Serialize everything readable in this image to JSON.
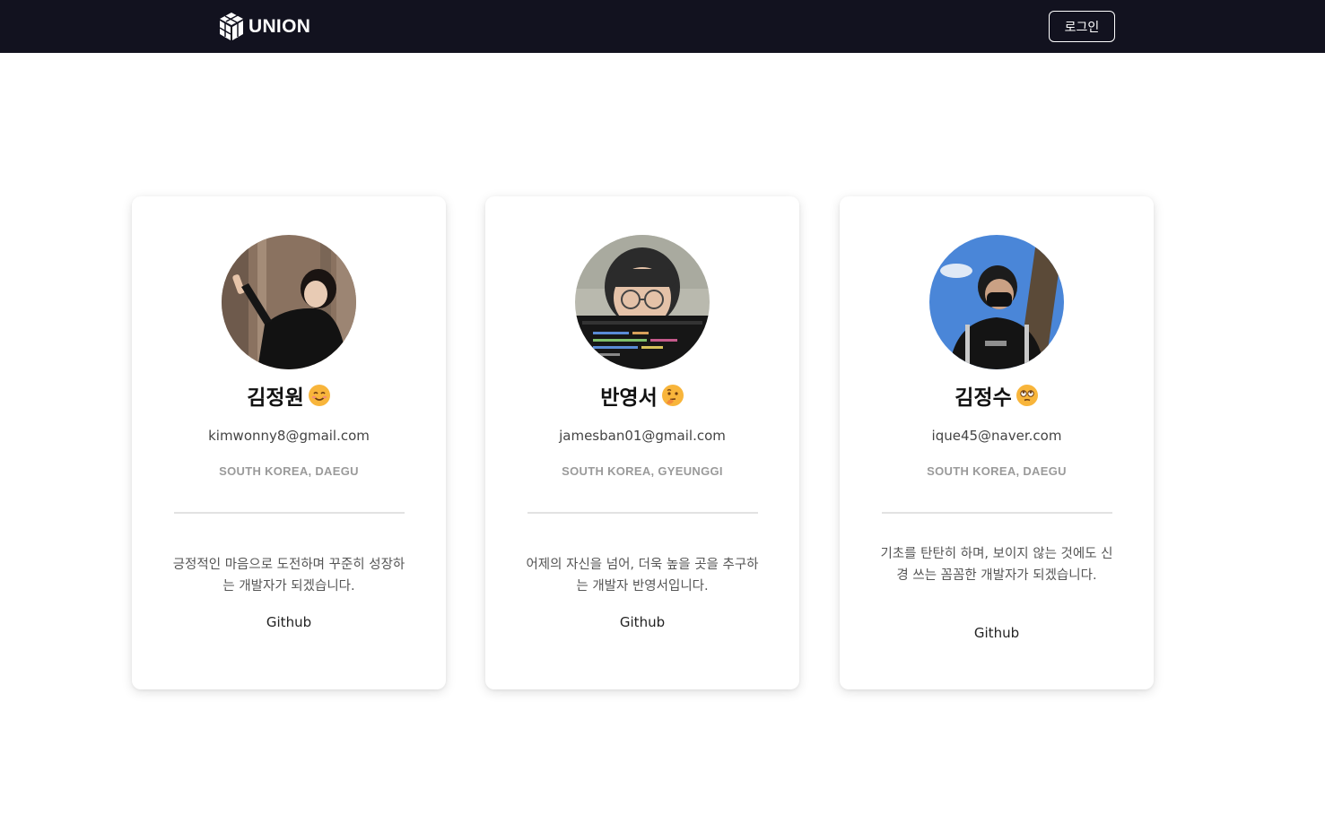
{
  "header": {
    "brand_name": "UNION",
    "brand_icon": "cube-logo-icon",
    "login_label": "로그인",
    "background_color": "#12121f"
  },
  "members": [
    {
      "name": "김정원",
      "emoji": "smiling-face-icon",
      "email": "kimwonny8@gmail.com",
      "location": "SOUTH KOREA, DAEGU",
      "bio": "긍정적인 마음으로 도전하며 꾸준히 성장하는 개발자가 되겠습니다.",
      "link_label": "Github"
    },
    {
      "name": "반영서",
      "emoji": "thinking-face-icon",
      "email": "jamesban01@gmail.com",
      "location": "SOUTH KOREA, GYEUNGGI",
      "bio": "어제의 자신을 넘어, 더욱 높을 곳을 추구하는 개발자 반영서입니다.",
      "link_label": "Github"
    },
    {
      "name": "김정수",
      "emoji": "eye-roll-face-icon",
      "email": "ique45@naver.com",
      "location": "SOUTH KOREA, DAEGU",
      "bio": "기초를 탄탄히 하며, 보이지 않는 것에도 신경 쓰는 꼼꼼한 개발자가 되겠습니다.",
      "link_label": "Github"
    }
  ]
}
